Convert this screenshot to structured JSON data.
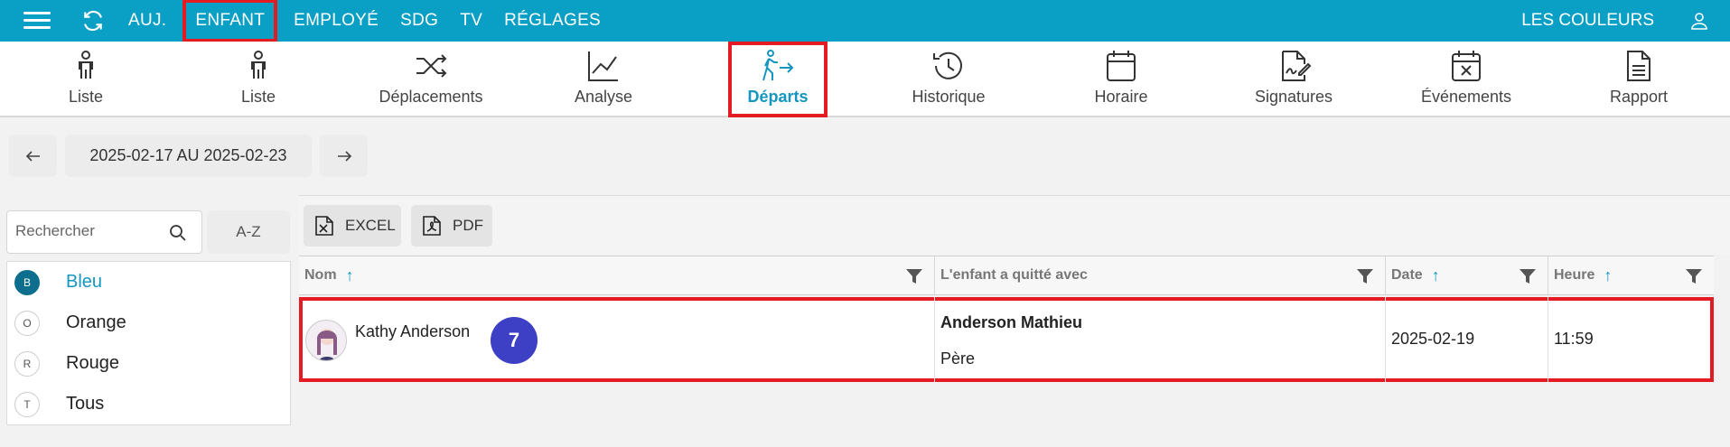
{
  "topbar": {
    "nav": [
      "AUJ.",
      "ENFANT",
      "EMPLOYÉ",
      "SDG",
      "TV",
      "RÉGLAGES"
    ],
    "active_nav": "ENFANT",
    "right_label": "LES COULEURS"
  },
  "subnav": {
    "items": [
      "Liste",
      "Liste",
      "Déplacements",
      "Analyse",
      "Départs",
      "Historique",
      "Horaire",
      "Signatures",
      "Événements",
      "Rapport"
    ],
    "active": "Départs"
  },
  "date_range": "2025-02-17 AU 2025-02-23",
  "search": {
    "placeholder": "Rechercher"
  },
  "sort_button": "A-Z",
  "groups": [
    {
      "letter": "B",
      "name": "Bleu",
      "active": true
    },
    {
      "letter": "O",
      "name": "Orange"
    },
    {
      "letter": "R",
      "name": "Rouge"
    },
    {
      "letter": "T",
      "name": "Tous"
    }
  ],
  "export": {
    "excel": "EXCEL",
    "pdf": "PDF"
  },
  "table": {
    "columns": [
      "Nom",
      "L'enfant a quitté avec",
      "Date",
      "Heure"
    ],
    "rows": [
      {
        "child": "Kathy Anderson",
        "badge": "7",
        "picked_up_by": "Anderson Mathieu",
        "relation": "Père",
        "date": "2025-02-19",
        "time": "11:59"
      }
    ]
  },
  "colors": {
    "primary": "#0a9fc4",
    "highlight": "#e41b23",
    "badge": "#3d3fc5"
  }
}
